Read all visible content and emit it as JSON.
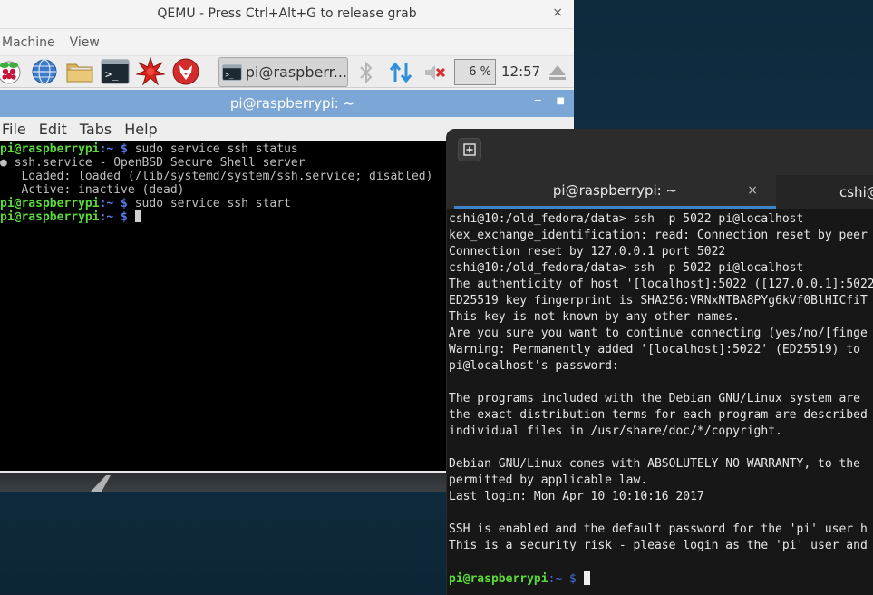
{
  "qemu": {
    "title": "QEMU - Press Ctrl+Alt+G to release grab",
    "close": "×",
    "menu": [
      "Machine",
      "View"
    ]
  },
  "panel": {
    "icons": [
      "raspberry-icon",
      "globe-icon",
      "folder-icon",
      "terminal-icon",
      "mathematica-icon",
      "wolfram-icon"
    ],
    "task_label": "pi@raspberr...",
    "cpu_usage": "6 %",
    "clock": "12:57"
  },
  "lxterminal": {
    "title": "pi@raspberrypi: ~",
    "buttons": [
      "‒",
      "■"
    ],
    "menu": [
      "File",
      "Edit",
      "Tabs",
      "Help"
    ],
    "prompt_user": "pi@raspberrypi",
    "prompt_path": ":~ $",
    "lines": [
      "sudo service ssh status",
      "● ssh.service - OpenBSD Secure Shell server",
      "   Loaded: loaded (/lib/systemd/system/ssh.service; disabled)",
      "   Active: inactive (dead)",
      "sudo service ssh start"
    ]
  },
  "host_terminal": {
    "tabs": [
      {
        "label": "pi@raspberrypi: ~",
        "close": "×"
      },
      {
        "label": "cshi@"
      }
    ],
    "lines": [
      "cshi@10:/old_fedora/data> ssh -p 5022 pi@localhost",
      "kex_exchange_identification: read: Connection reset by peer",
      "Connection reset by 127.0.0.1 port 5022",
      "cshi@10:/old_fedora/data> ssh -p 5022 pi@localhost",
      "The authenticity of host '[localhost]:5022 ([127.0.0.1]:5022)",
      "ED25519 key fingerprint is SHA256:VRNxNTBA8PYg6kVf0BlHICfiT",
      "This key is not known by any other names.",
      "Are you sure you want to continue connecting (yes/no/[finge",
      "Warning: Permanently added '[localhost]:5022' (ED25519) to",
      "pi@localhost's password:",
      "",
      "The programs included with the Debian GNU/Linux system are",
      "the exact distribution terms for each program are described",
      "individual files in /usr/share/doc/*/copyright.",
      "",
      "Debian GNU/Linux comes with ABSOLUTELY NO WARRANTY, to the",
      "permitted by applicable law.",
      "Last login: Mon Apr 10 10:10:16 2017",
      "",
      "SSH is enabled and the default password for the 'pi' user h",
      "This is a security risk - please login as the 'pi' user and",
      ""
    ],
    "prompt_user": "pi@raspberrypi",
    "prompt_path": ":~ $"
  }
}
